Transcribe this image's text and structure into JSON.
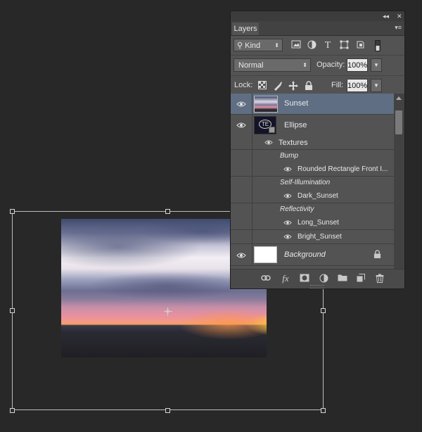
{
  "panel": {
    "collapse_glyph": "◂◂",
    "close_glyph": "✕",
    "tab_label": "Layers",
    "menu_glyph": "▾≡",
    "filter": {
      "kind_label": "Kind",
      "icons": [
        "image-filter-icon",
        "adjustment-filter-icon",
        "type-filter-icon",
        "shape-filter-icon",
        "smart-object-filter-icon",
        "filter-toggle-icon"
      ]
    },
    "blend": {
      "mode": "Normal",
      "opacity_label": "Opacity:",
      "opacity_value": "100%",
      "lock_label": "Lock:",
      "fill_label": "Fill:",
      "fill_value": "100%"
    },
    "layers": [
      {
        "name": "Sunset",
        "selected": true,
        "visible": true
      },
      {
        "name": "Ellipse",
        "visible": true,
        "thumb_text": "TE"
      },
      {
        "name": "Textures",
        "visible": true
      },
      {
        "name": "Bump",
        "group_label": true
      },
      {
        "name": "Rounded Rectangle Front I...",
        "visible": true
      },
      {
        "name": "Self-Illumination",
        "group_label": true
      },
      {
        "name": "Dark_Sunset",
        "visible": true
      },
      {
        "name": "Reflectivity",
        "group_label": true
      },
      {
        "name": "Long_Sunset",
        "visible": true
      },
      {
        "name": "Bright_Sunset",
        "visible": true
      },
      {
        "name": "Background",
        "visible": true,
        "locked": true
      }
    ],
    "bottom_icons": [
      "link-icon",
      "fx-icon",
      "mask-icon",
      "adjustment-icon",
      "folder-icon",
      "new-layer-icon",
      "trash-icon"
    ],
    "fx_label": "fx"
  },
  "colors": {
    "panel_bg": "#535353",
    "selected_row": "#5f6e82",
    "canvas_bg": "#282828"
  }
}
